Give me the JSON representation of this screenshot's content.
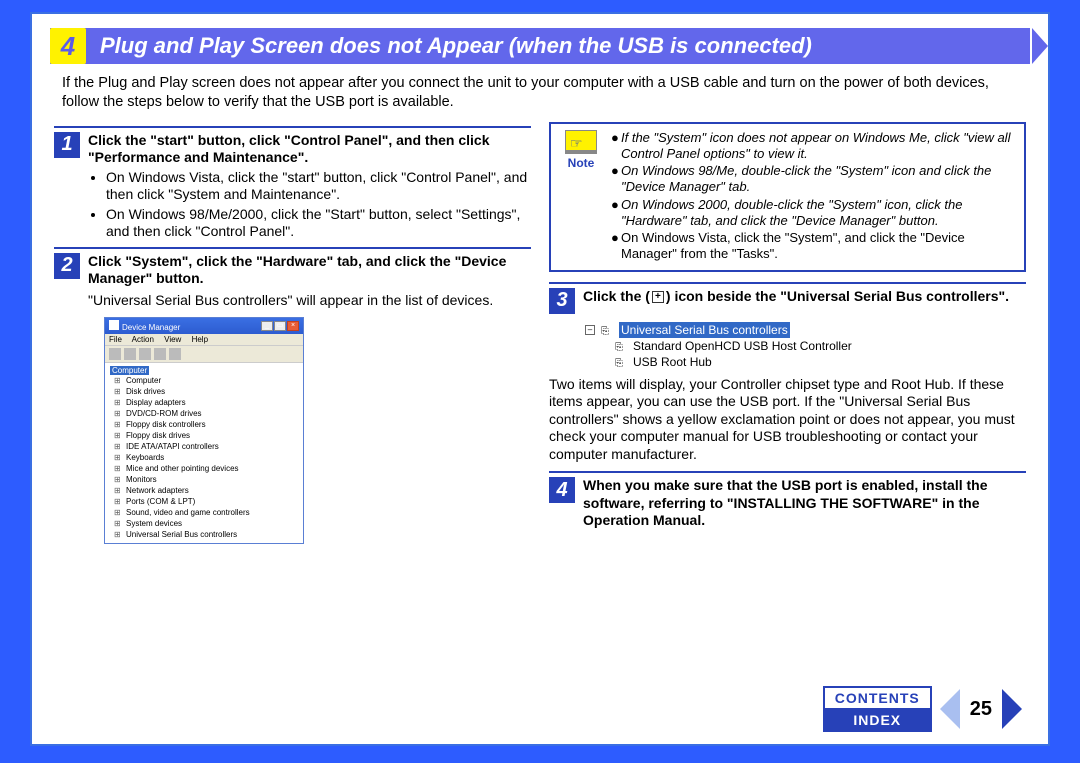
{
  "title": {
    "number": "4",
    "text": "Plug and Play Screen does not Appear (when the USB is connected)"
  },
  "intro": "If the Plug and Play screen does not appear after you connect the unit to your computer with a USB cable and turn on the power of both devices, follow the steps below to verify that the USB port is available.",
  "step1": {
    "num": "1",
    "head": "Click the \"start\" button, click \"Control Panel\", and then click \"Performance and Maintenance\".",
    "b1": "On Windows Vista, click the \"start\" button, click \"Control Panel\", and then click \"System and Maintenance\".",
    "b2": "On Windows 98/Me/2000, click the \"Start\" button, select \"Settings\", and then click \"Control Panel\"."
  },
  "step2": {
    "num": "2",
    "head": "Click \"System\", click the \"Hardware\" tab, and click the \"Device Manager\" button.",
    "text": "\"Universal Serial Bus controllers\" will appear in the list of devices."
  },
  "dm": {
    "title": "Device Manager",
    "menu": {
      "file": "File",
      "action": "Action",
      "view": "View",
      "help": "Help"
    },
    "root": "Computer",
    "items": [
      "Computer",
      "Disk drives",
      "Display adapters",
      "DVD/CD-ROM drives",
      "Floppy disk controllers",
      "Floppy disk drives",
      "IDE ATA/ATAPI controllers",
      "Keyboards",
      "Mice and other pointing devices",
      "Monitors",
      "Network adapters",
      "Ports (COM & LPT)",
      "Sound, video and game controllers",
      "System devices",
      "Universal Serial Bus controllers"
    ]
  },
  "note": {
    "label": "Note",
    "n1": "If the \"System\" icon does not appear on Windows Me, click \"view all Control Panel options\" to view it.",
    "n2": "On Windows 98/Me, double-click the \"System\" icon and click the \"Device Manager\" tab.",
    "n3": "On Windows 2000, double-click the \"System\" icon, click the \"Hardware\" tab, and click the \"Device Manager\" button.",
    "n4a": "On Windows Vista, click the \"System\", and click the \"Device Manager\" from the \"Tasks\"."
  },
  "step3": {
    "num": "3",
    "head_a": "Click the (",
    "plus": "+",
    "head_b": ") icon beside the \"Universal Serial Bus controllers\"."
  },
  "usb": {
    "minus": "–",
    "root": "Universal Serial Bus controllers",
    "c1": "Standard OpenHCD USB Host Controller",
    "c2": "USB Root Hub"
  },
  "para3": "Two items will display, your Controller chipset type and Root Hub. If these items appear, you can use the USB port. If the \"Universal Serial Bus controllers\" shows a yellow exclamation point or does not appear, you must check your computer manual for USB troubleshooting or contact your computer manufacturer.",
  "step4": {
    "num": "4",
    "head": "When you make sure that the USB port is enabled, install the software, referring to \"INSTALLING THE SOFTWARE\" in the Operation Manual."
  },
  "footer": {
    "contents": "CONTENTS",
    "index": "INDEX",
    "page": "25"
  }
}
